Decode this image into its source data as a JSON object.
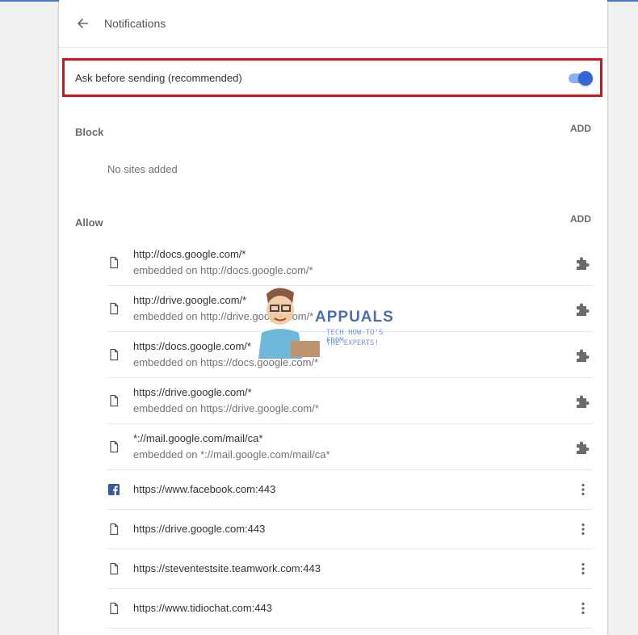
{
  "header": {
    "title": "Notifications"
  },
  "ask": {
    "label": "Ask before sending (recommended)",
    "toggle_on": true
  },
  "block": {
    "title": "Block",
    "add_label": "ADD",
    "empty_text": "No sites added"
  },
  "allow": {
    "title": "Allow",
    "add_label": "ADD",
    "sites": [
      {
        "url": "http://docs.google.com/*",
        "embedded": "embedded on http://docs.google.com/*",
        "icon": "file-icon",
        "action": "extension-puzzle-icon"
      },
      {
        "url": "http://drive.google.com/*",
        "embedded": "embedded on http://drive.google.com/*",
        "icon": "file-icon",
        "action": "extension-puzzle-icon"
      },
      {
        "url": "https://docs.google.com/*",
        "embedded": "embedded on https://docs.google.com/*",
        "icon": "file-icon",
        "action": "extension-puzzle-icon"
      },
      {
        "url": "https://drive.google.com/*",
        "embedded": "embedded on https://drive.google.com/*",
        "icon": "file-icon",
        "action": "extension-puzzle-icon"
      },
      {
        "url": "*://mail.google.com/mail/ca*",
        "embedded": "embedded on *://mail.google.com/mail/ca*",
        "icon": "file-icon",
        "action": "extension-puzzle-icon"
      },
      {
        "url": "https://www.facebook.com:443",
        "icon": "facebook-icon",
        "action": "more-vert-icon"
      },
      {
        "url": "https://drive.google.com:443",
        "icon": "file-icon",
        "action": "more-vert-icon"
      },
      {
        "url": "https://steventestsite.teamwork.com:443",
        "icon": "file-icon",
        "action": "more-vert-icon"
      },
      {
        "url": "https://www.tidiochat.com:443",
        "icon": "file-icon",
        "action": "more-vert-icon"
      }
    ]
  },
  "watermark": {
    "brand": "APPUALS",
    "tagline_1": "TECH HOW-TO'S FROM",
    "tagline_2": "THE EXPERTS!"
  },
  "colors": {
    "accent": "#3367d6",
    "highlight_border": "#d8111a",
    "facebook": "#3b5998"
  }
}
